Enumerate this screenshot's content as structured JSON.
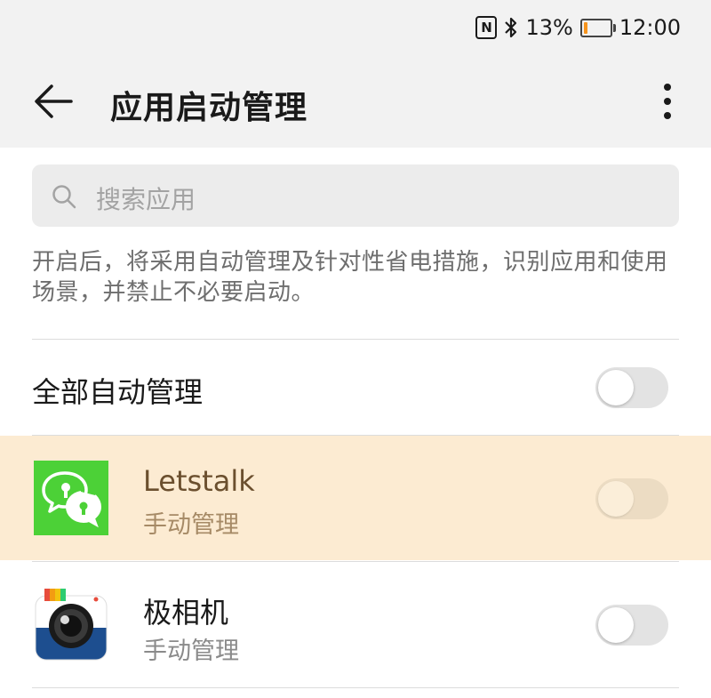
{
  "status_bar": {
    "battery_percent": "13%",
    "battery_level": 0.13,
    "time": "12:00",
    "icons": [
      "nfc-icon",
      "bluetooth-icon",
      "battery-icon"
    ]
  },
  "app_bar": {
    "title": "应用启动管理",
    "back_icon": "arrow-left-icon",
    "more_icon": "more-vertical-icon"
  },
  "search": {
    "placeholder": "搜索应用"
  },
  "description": "开启后，将采用自动管理及针对性省电措施，识别应用和使用场景，并禁止不必要启动。",
  "master_toggle": {
    "label": "全部自动管理",
    "on": false
  },
  "apps": [
    {
      "name": "Letstalk",
      "status": "手动管理",
      "toggle_on": false,
      "highlighted": true,
      "accent": "#4cd137"
    },
    {
      "name": "极相机",
      "status": "手动管理",
      "toggle_on": false,
      "highlighted": false,
      "accent": "#1d4e8f"
    }
  ],
  "colors": {
    "highlight_bg": "#fcebd2",
    "battery_low": "#f7941d",
    "toggle_off": "#e3e3e3"
  }
}
